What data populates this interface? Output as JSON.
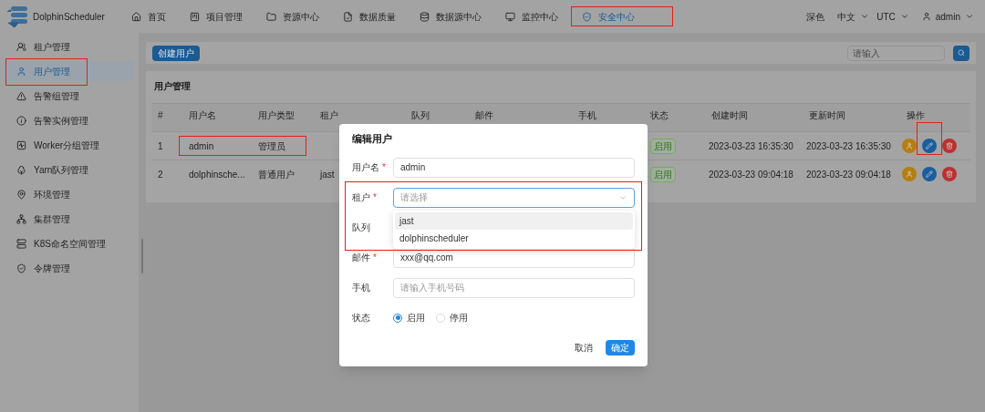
{
  "header": {
    "logo_text": "DolphinScheduler",
    "nav": [
      {
        "label": "首页",
        "selected": false,
        "highlighted": false
      },
      {
        "label": "项目管理",
        "selected": false,
        "highlighted": false
      },
      {
        "label": "资源中心",
        "selected": false,
        "highlighted": false
      },
      {
        "label": "数据质量",
        "selected": false,
        "highlighted": false
      },
      {
        "label": "数据源中心",
        "selected": false,
        "highlighted": false
      },
      {
        "label": "监控中心",
        "selected": false,
        "highlighted": false
      },
      {
        "label": "安全中心",
        "selected": true,
        "highlighted": true
      }
    ],
    "theme": "深色",
    "language": "中文",
    "timezone": "UTC",
    "user": "admin"
  },
  "sidebar": {
    "items": [
      {
        "label": "租户管理",
        "selected": false,
        "highlighted": false
      },
      {
        "label": "用户管理",
        "selected": true,
        "highlighted": true
      },
      {
        "label": "告警组管理",
        "selected": false,
        "highlighted": false
      },
      {
        "label": "告警实例管理",
        "selected": false,
        "highlighted": false
      },
      {
        "label": "Worker分组管理",
        "selected": false,
        "highlighted": false
      },
      {
        "label": "Yarn队列管理",
        "selected": false,
        "highlighted": false
      },
      {
        "label": "环境管理",
        "selected": false,
        "highlighted": false
      },
      {
        "label": "集群管理",
        "selected": false,
        "highlighted": false
      },
      {
        "label": "K8S命名空间管理",
        "selected": false,
        "highlighted": false
      },
      {
        "label": "令牌管理",
        "selected": false,
        "highlighted": false
      }
    ]
  },
  "toolbar": {
    "create_button": "创建用户",
    "search": {
      "placeholder": "请输入"
    }
  },
  "card": {
    "title": "用户管理",
    "columns": [
      "#",
      "用户名",
      "用户类型",
      "租户",
      "队列",
      "邮件",
      "手机",
      "状态",
      "创建时间",
      "更新时间",
      "操作"
    ],
    "rows": [
      {
        "index": "1",
        "username": "admin",
        "user_type": "管理员",
        "tenant": "",
        "status": "启用",
        "created": "2023-03-23 16:35:30",
        "updated": "2023-03-23 16:35:30",
        "highlighted": true,
        "edit_highlighted": true
      },
      {
        "index": "2",
        "username": "dolphinsche...",
        "user_type": "普通用户",
        "tenant": "jast",
        "status": "启用",
        "created": "2023-03-23 09:04:18",
        "updated": "2023-03-23 09:04:18",
        "highlighted": false,
        "edit_highlighted": false
      }
    ]
  },
  "dialog": {
    "title": "编辑用户",
    "fields": [
      {
        "kind": "input",
        "label": "用户名",
        "required_mark": "*",
        "value": "admin"
      },
      {
        "kind": "select",
        "label": "租户",
        "required_mark": "*",
        "placeholder": "请选择",
        "highlighted": true,
        "options": [
          {
            "label": "jast",
            "hovered": true
          },
          {
            "label": "dolphinscheduler",
            "hovered": false
          }
        ]
      },
      {
        "kind": "hidden",
        "label": "队列"
      },
      {
        "kind": "input",
        "label": "邮件",
        "required_mark": "*",
        "value": "xxx@qq.com"
      },
      {
        "kind": "input",
        "label": "手机",
        "placeholder": "请输入手机号码"
      },
      {
        "kind": "radio",
        "label": "状态",
        "options": [
          {
            "label": "启用",
            "selected": true
          },
          {
            "label": "停用",
            "selected": false
          }
        ]
      }
    ],
    "cancel_button": "取消",
    "confirm_button": "确定"
  }
}
